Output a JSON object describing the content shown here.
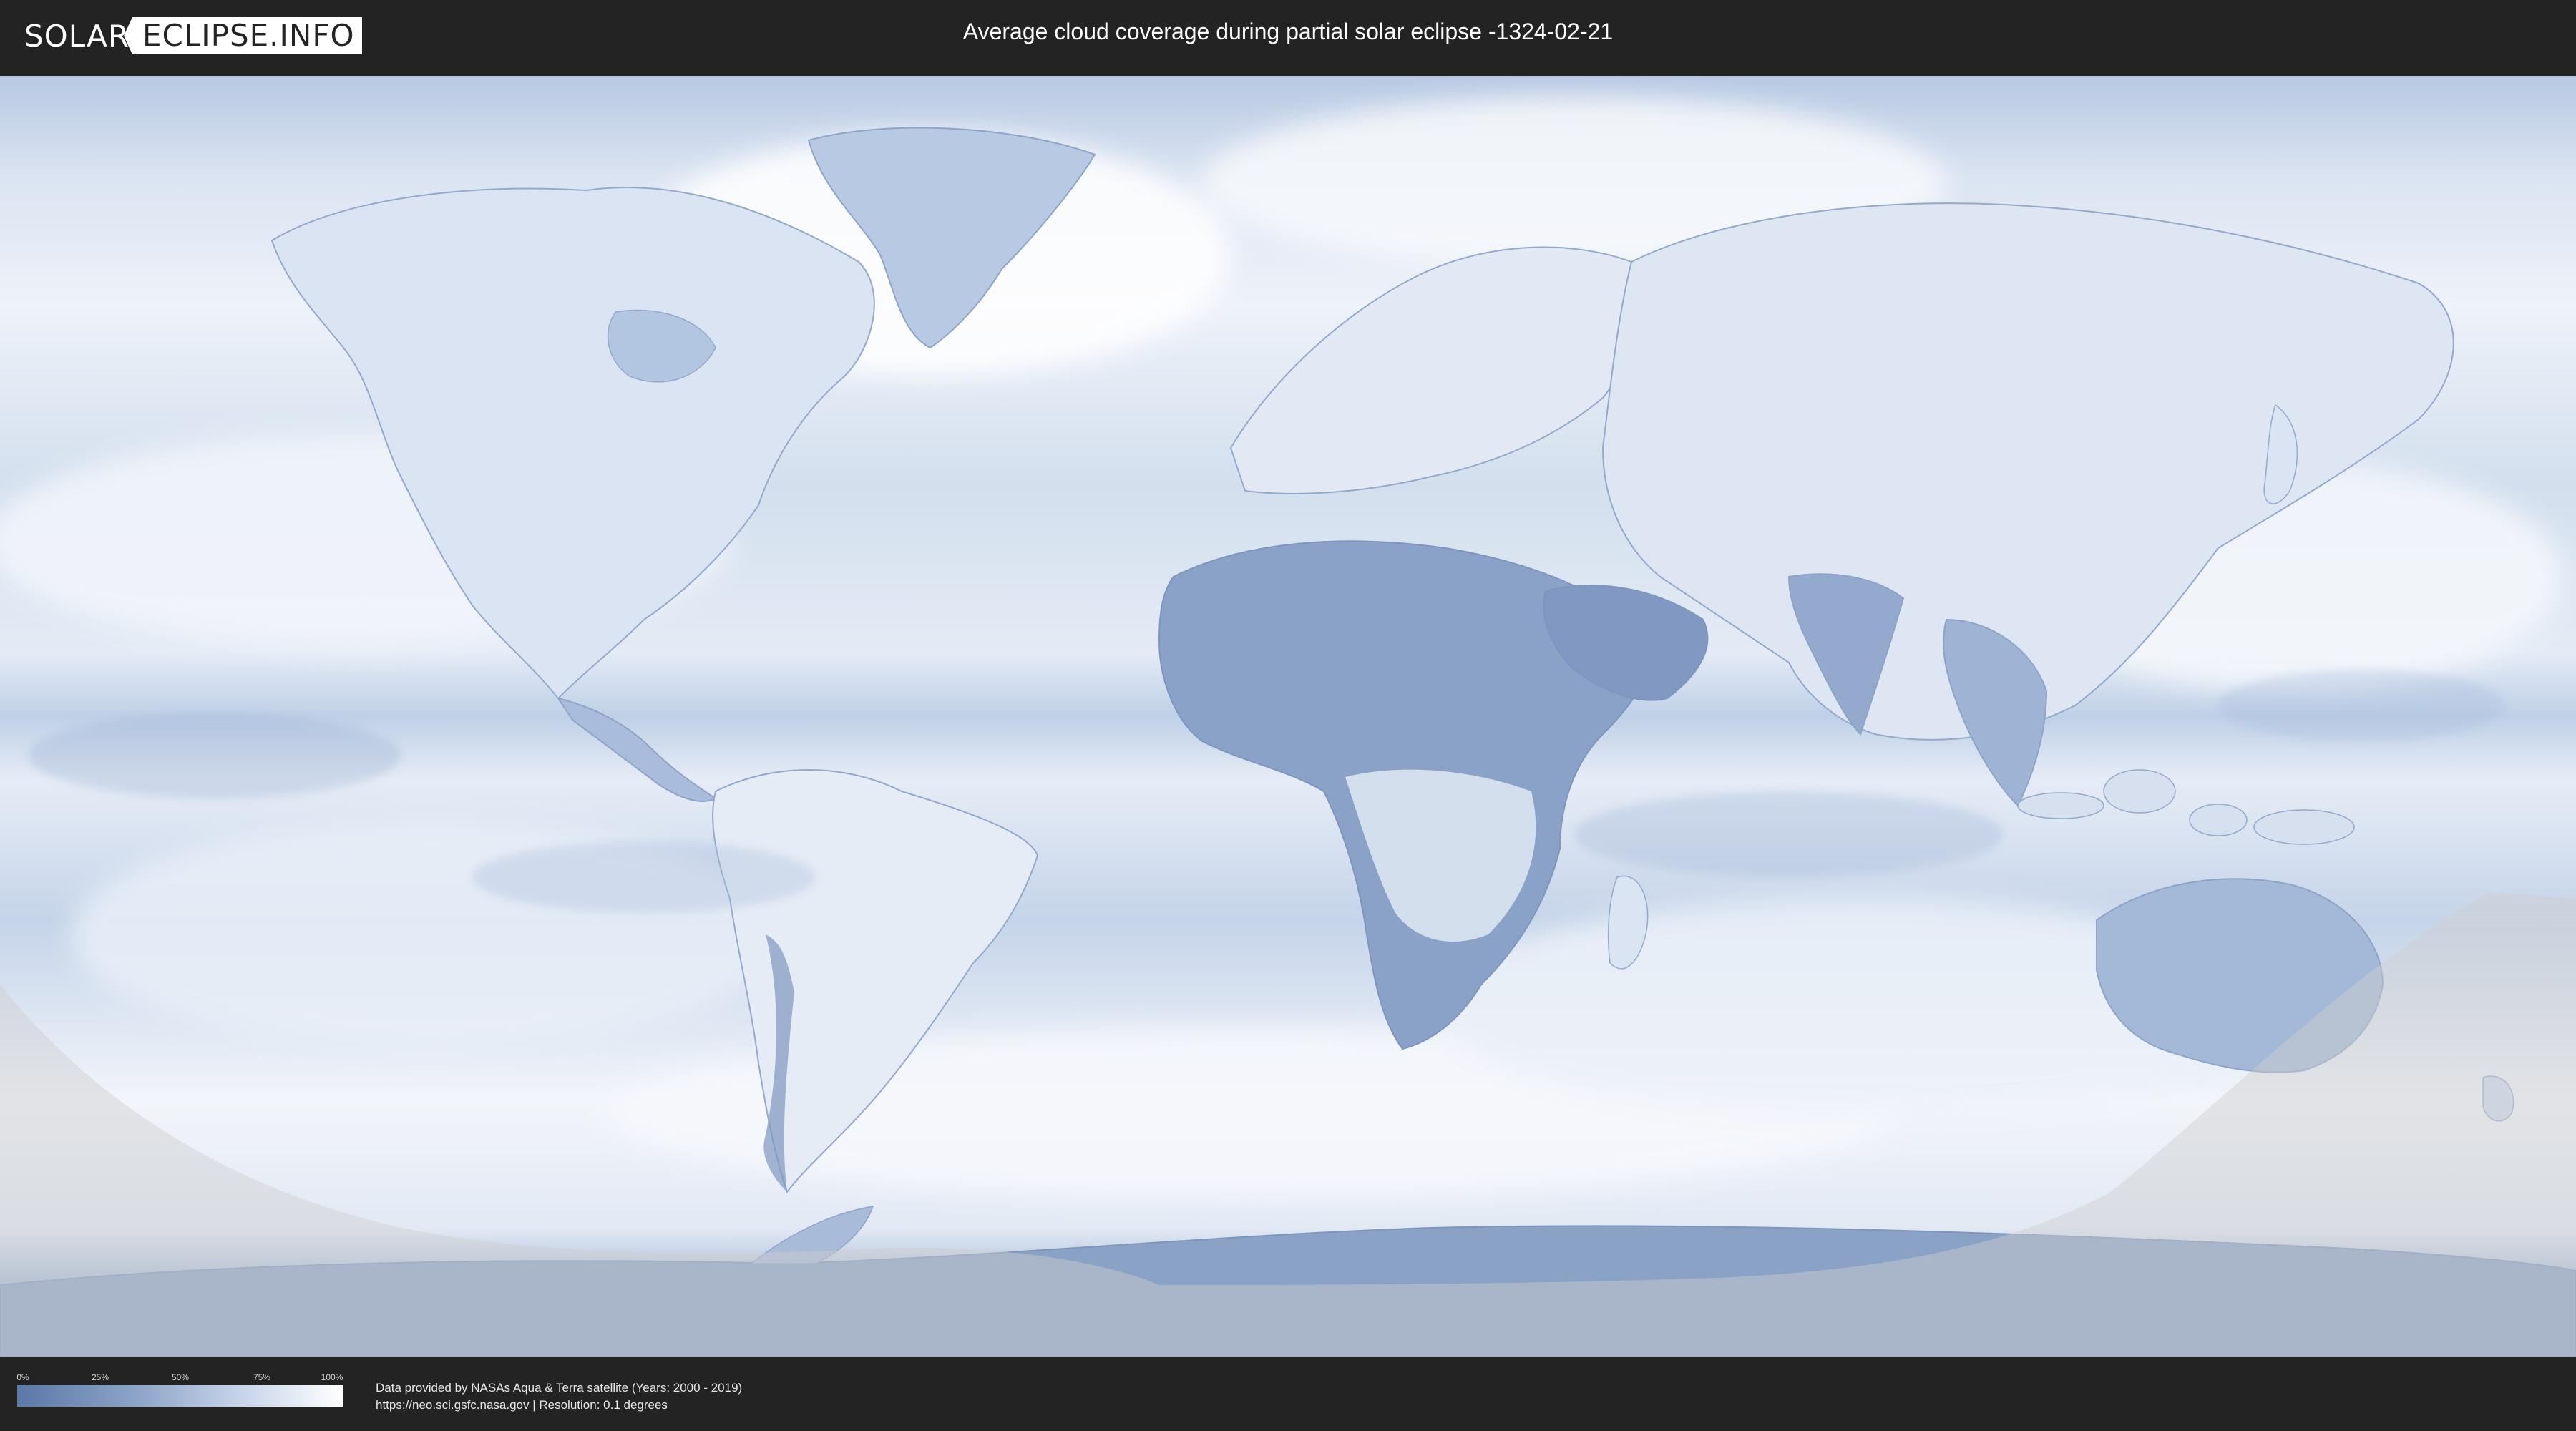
{
  "header": {
    "logo_part_a": "SOLAR",
    "logo_part_b": "ECLIPSE.INFO",
    "title": "Average cloud coverage during partial solar eclipse -1324-02-21"
  },
  "map": {
    "ocean_color": "#c4d3e8",
    "cloud_color": "#ffffff",
    "land_clear_color": "#6f8cb9",
    "eclipse_shadow_color": "#cfcfcf"
  },
  "legend": {
    "ticks": [
      "0%",
      "25%",
      "50%",
      "75%",
      "100%"
    ],
    "gradient_colors": [
      "#5a78a8",
      "#8aa2c6",
      "#c9d6ea",
      "#ffffff"
    ]
  },
  "footer": {
    "source_line": "Data provided by NASAs Aqua & Terra satellite (Years: 2000 - 2019)",
    "resolution_line": "https://neo.sci.gsfc.nasa.gov | Resolution: 0.1 degrees"
  }
}
